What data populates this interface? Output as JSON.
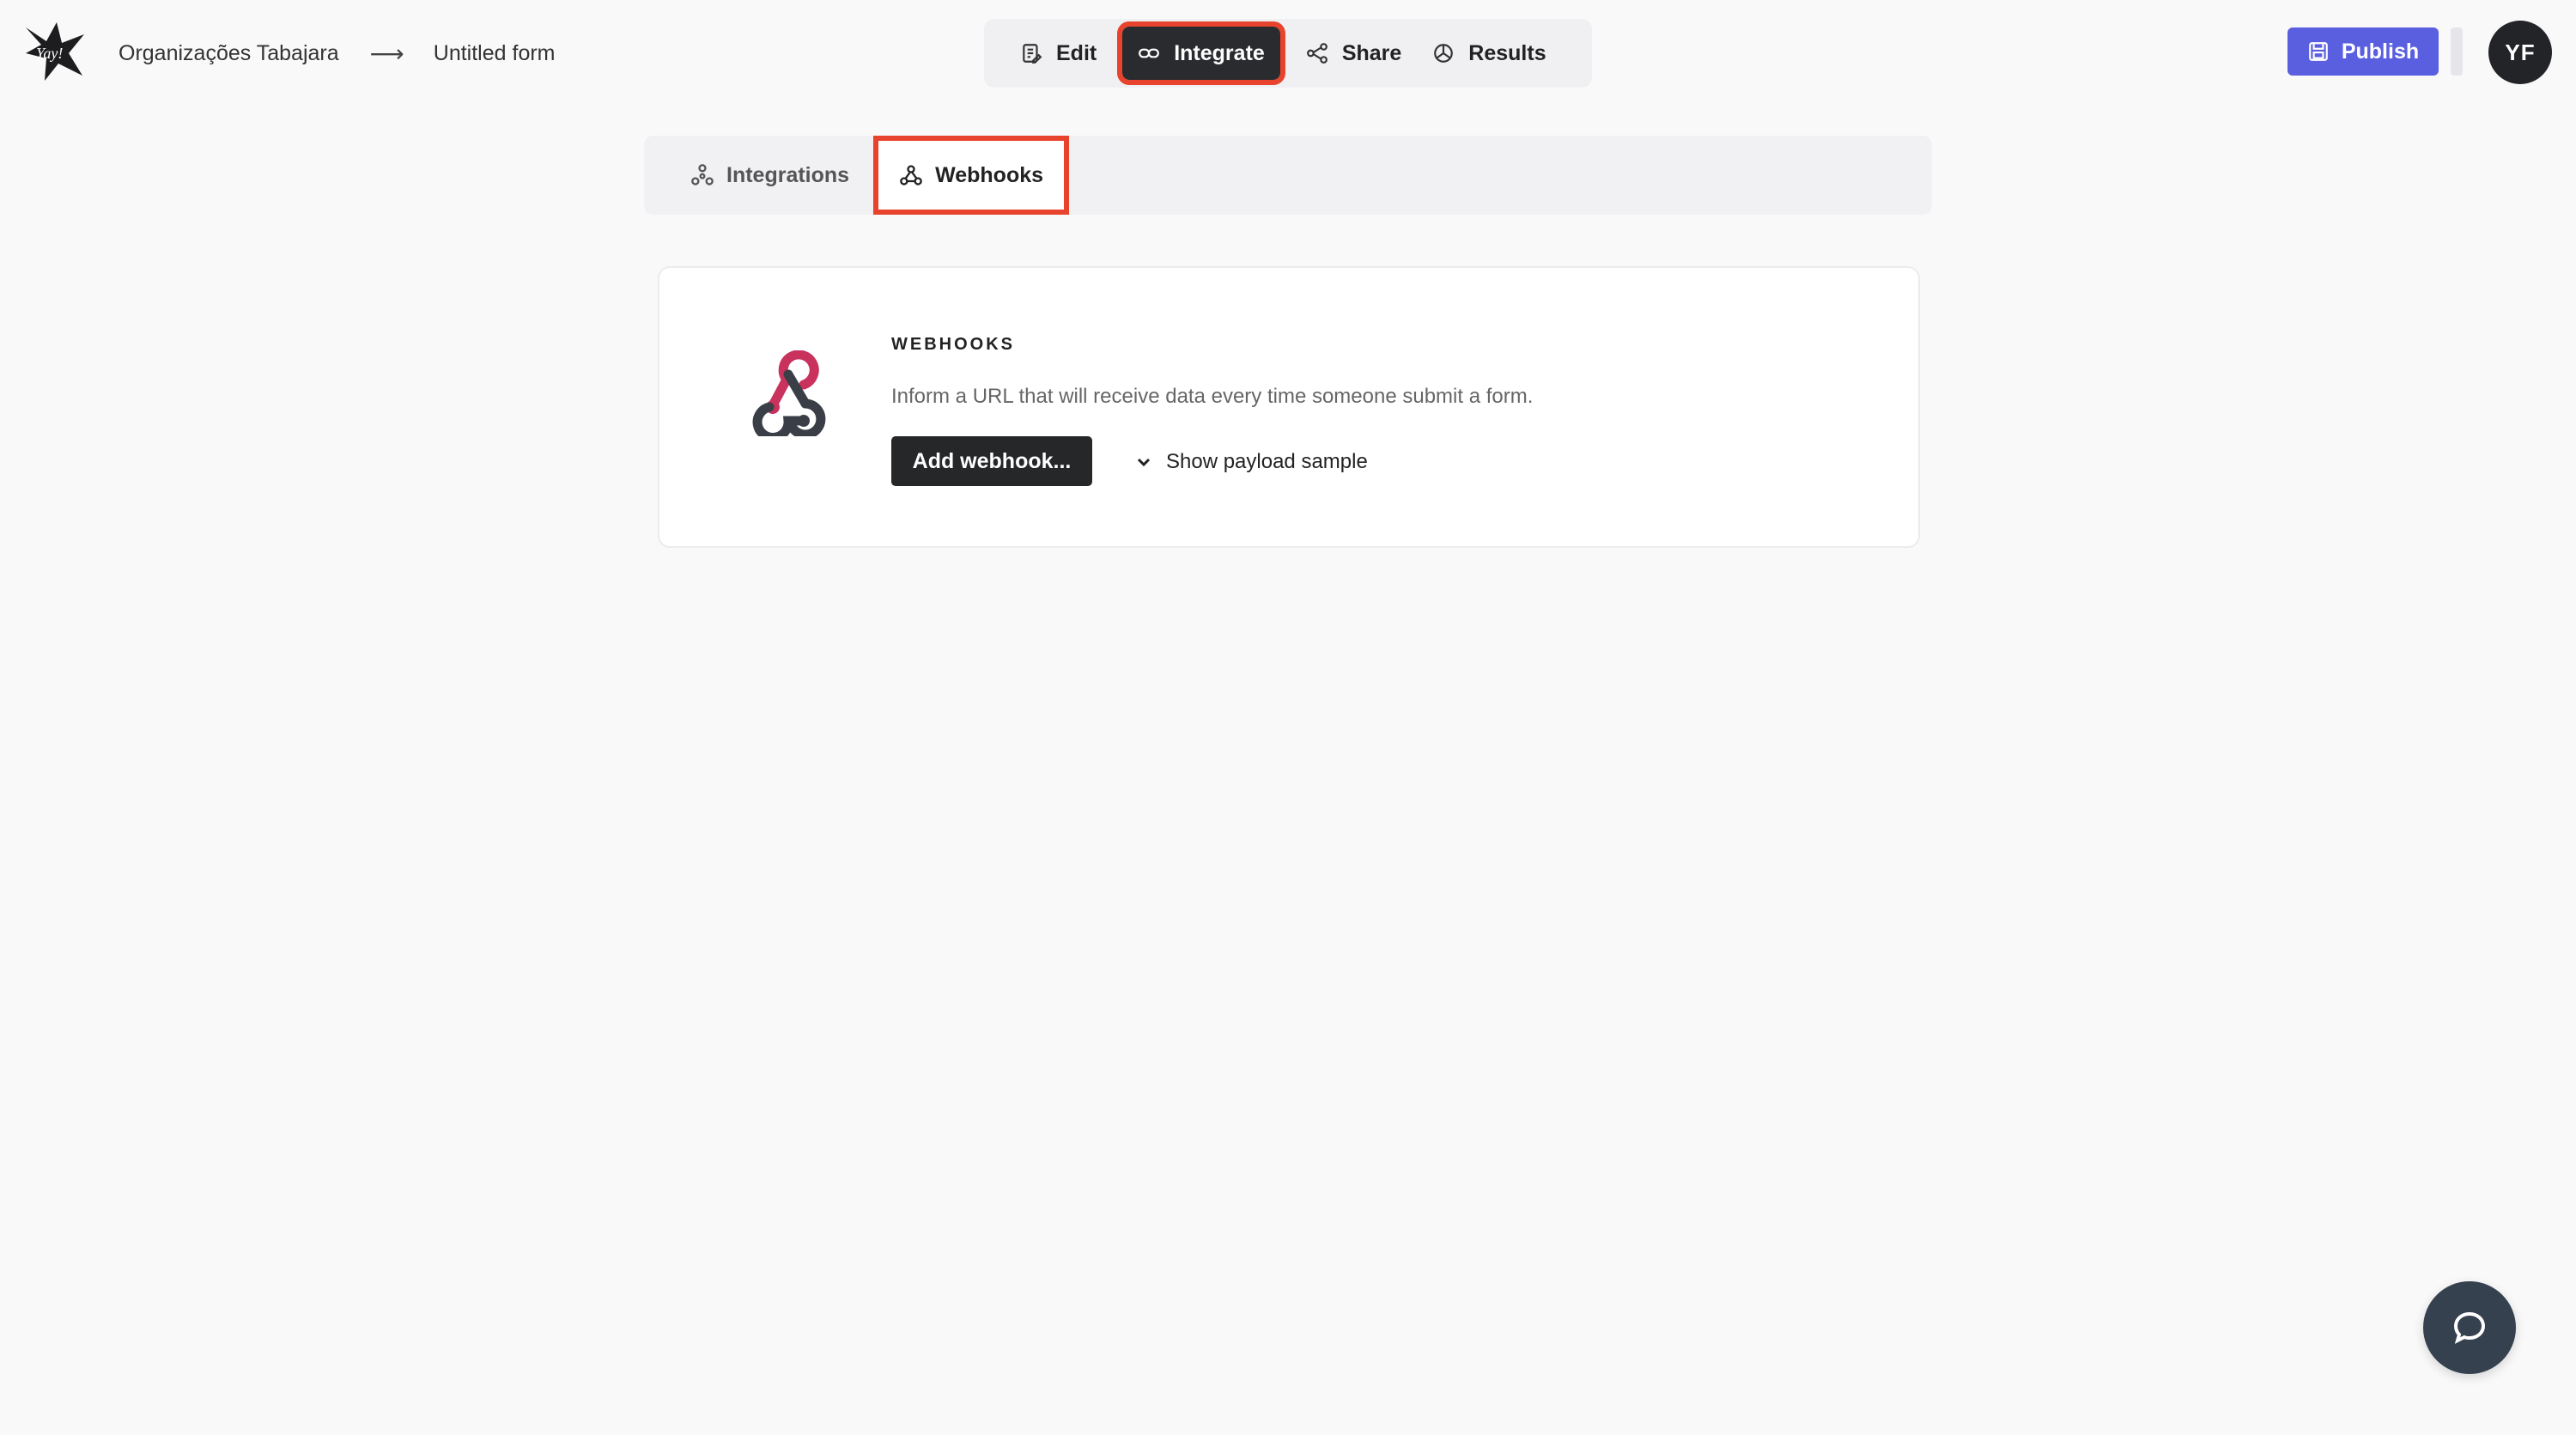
{
  "header": {
    "workspace": "Organizações Tabajara",
    "arrow": "⟶",
    "form_name": "Untitled form"
  },
  "mode_nav": {
    "tabs": [
      {
        "label": "Edit",
        "icon": "edit-icon"
      },
      {
        "label": "Integrate",
        "icon": "link-icon",
        "active": true
      },
      {
        "label": "Share",
        "icon": "share-icon"
      },
      {
        "label": "Results",
        "icon": "results-icon"
      }
    ]
  },
  "actions": {
    "publish_label": "Publish",
    "avatar_initials": "YF"
  },
  "subtabs": [
    {
      "label": "Integrations",
      "icon": "integrations-icon"
    },
    {
      "label": "Webhooks",
      "icon": "webhook-icon",
      "active": true
    }
  ],
  "webhooks_card": {
    "title": "WEBHOOKS",
    "description": "Inform a URL that will receive data every time someone submit a form.",
    "add_button": "Add webhook...",
    "payload_toggle": "Show payload sample"
  },
  "colors": {
    "accent": "#5a5fe0",
    "highlight": "#e8432d",
    "dark": "#2a2b2e",
    "webhook_pink": "#c8325d",
    "webhook_dark": "#3a3e46"
  }
}
